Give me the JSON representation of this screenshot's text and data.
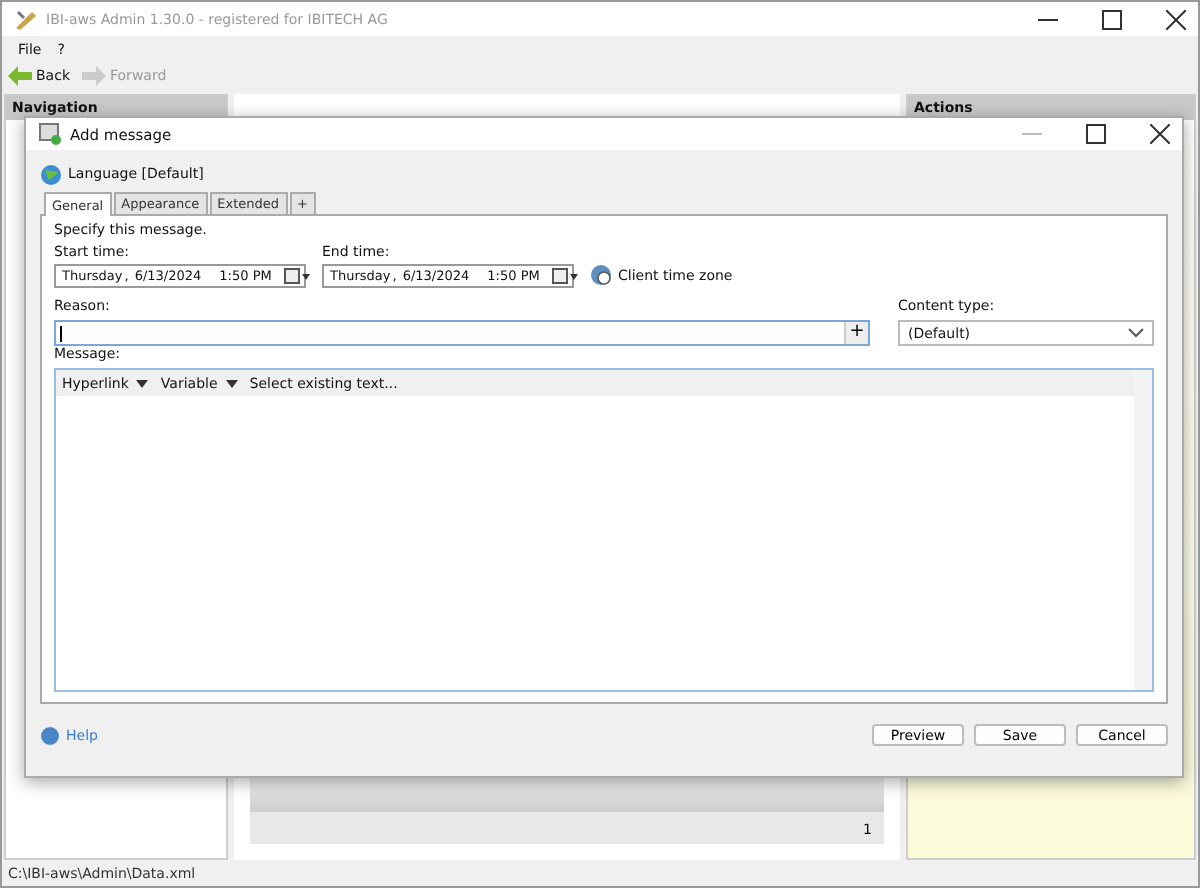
{
  "window": {
    "title": "IBI-aws Admin 1.30.0 - registered for IBITECH AG"
  },
  "menu": [
    "File",
    "?"
  ],
  "toolbar": [
    {
      "label": "Back",
      "disabled": false
    },
    {
      "label": "Forward",
      "disabled": true
    }
  ],
  "navigation": {
    "title": "Navigation"
  },
  "actions": {
    "title": "Actions"
  },
  "center": {
    "count": "1"
  },
  "status_bar": "C:\\IBI-aws\\Admin\\Data.xml",
  "dialog": {
    "title": "Add message",
    "language": "Language [Default]",
    "tabs": [
      {
        "label": "General",
        "selected": true
      },
      {
        "label": "Appearance",
        "selected": false
      },
      {
        "label": "Extended",
        "selected": false
      },
      {
        "label": "+",
        "selected": false
      }
    ],
    "intro": "Specify this message.",
    "start": {
      "label": "Start time:",
      "day": "Thursday",
      "sep": ",",
      "date": "6/13/2024",
      "time": "1:50 PM"
    },
    "end": {
      "label": "End time:",
      "day": "Thursday",
      "sep": ",",
      "date": "6/13/2024",
      "time": "1:50 PM"
    },
    "timezone": "Client time zone",
    "reason": {
      "label": "Reason:",
      "button": "+"
    },
    "content_type": {
      "label": "Content type:",
      "value": "(Default)"
    },
    "message": {
      "label": "Message:",
      "tools": [
        "Hyperlink",
        "Variable",
        "Select existing text..."
      ]
    },
    "help": "Help",
    "buttons": [
      "Preview",
      "Save",
      "Cancel"
    ]
  }
}
